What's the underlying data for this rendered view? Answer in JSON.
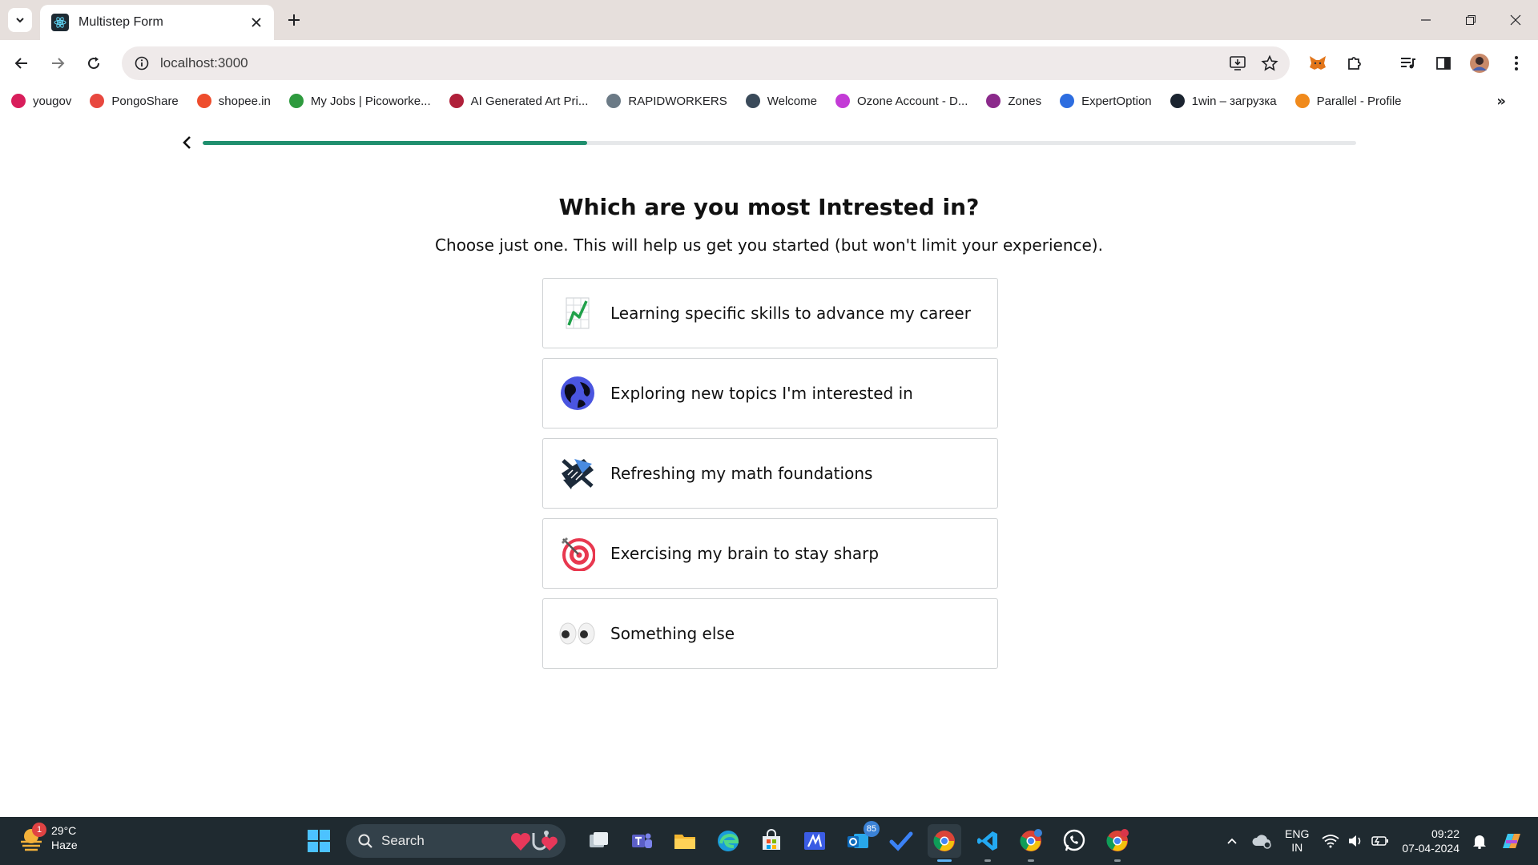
{
  "browser": {
    "tab_title": "Multistep Form",
    "url": "localhost:3000",
    "bookmarks": [
      {
        "label": "yougov",
        "icon": "yougov-icon",
        "color": "#d81e5b"
      },
      {
        "label": "PongoShare",
        "icon": "pongoshare-icon",
        "color": "#e8483f"
      },
      {
        "label": "shopee.in",
        "icon": "shopee-icon",
        "color": "#ee4d2d"
      },
      {
        "label": "My Jobs | Picoworke...",
        "icon": "picoworkers-icon",
        "color": "#2e9a3e"
      },
      {
        "label": "AI Generated Art Pri...",
        "icon": "nightcafe-icon",
        "color": "#b0203a"
      },
      {
        "label": "RAPIDWORKERS",
        "icon": "rapidworkers-icon",
        "color": "#6b7a86"
      },
      {
        "label": "Welcome",
        "icon": "welcome-icon",
        "color": "#3a4a5a"
      },
      {
        "label": "Ozone Account - D...",
        "icon": "ozone-icon",
        "color": "#c33bd6"
      },
      {
        "label": "Zones",
        "icon": "zones-icon",
        "color": "#8b2a8b"
      },
      {
        "label": "ExpertOption",
        "icon": "expertoption-icon",
        "color": "#2d6de0"
      },
      {
        "label": "1win – загрузка",
        "icon": "onewin-icon",
        "color": "#1b2430"
      },
      {
        "label": "Parallel - Profile",
        "icon": "parallel-icon",
        "color": "#f08a1c"
      }
    ]
  },
  "form": {
    "progress_fraction": 0.333,
    "question": "Which are you most Intrested in?",
    "subtitle": "Choose just one. This will help us get you started (but won't limit your experience).",
    "options": [
      {
        "label": "Learning specific skills to advance my career",
        "icon": "chart-growth-icon"
      },
      {
        "label": "Exploring new topics I'm interested in",
        "icon": "globe-icon"
      },
      {
        "label": "Refreshing my math foundations",
        "icon": "math-shapes-icon"
      },
      {
        "label": "Exercising my brain to stay sharp",
        "icon": "target-icon"
      },
      {
        "label": "Something else",
        "icon": "eyes-icon"
      }
    ]
  },
  "taskbar": {
    "weather_temp": "29°C",
    "weather_desc": "Haze",
    "weather_badge": "1",
    "search_label": "Search",
    "outlook_badge": "85",
    "lang_line1": "ENG",
    "lang_line2": "IN",
    "time": "09:22",
    "date": "07-04-2024"
  }
}
